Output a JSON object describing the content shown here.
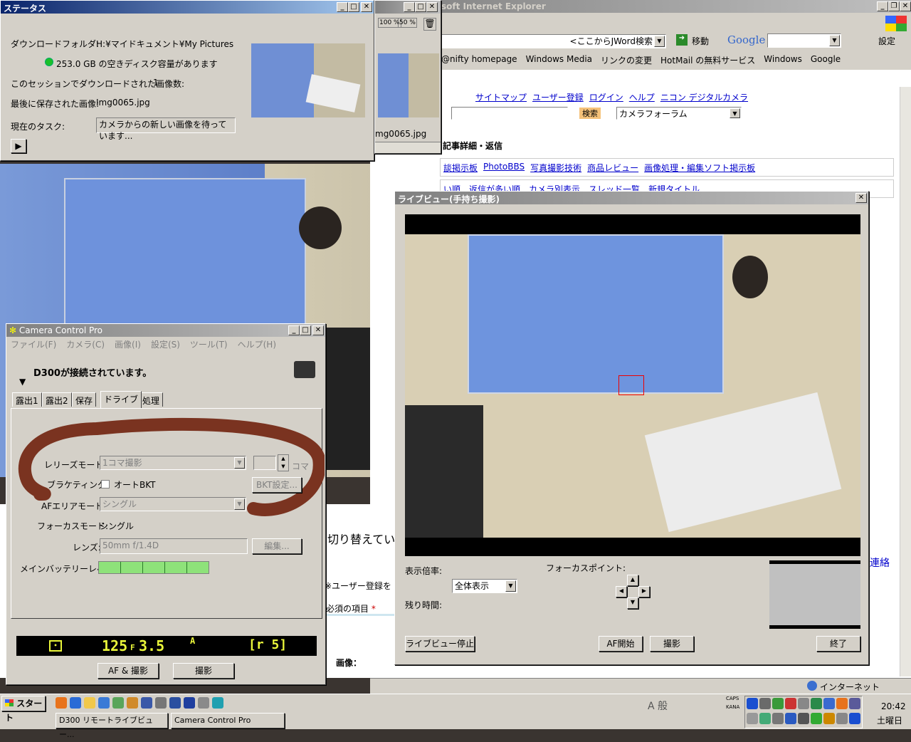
{
  "ie": {
    "title": "soft Internet Explorer",
    "search_hint": "<ここからJWord検索",
    "move_label": "移動",
    "google_label": "Google",
    "settings_label": "設定",
    "links": [
      "@nifty homepage",
      "Windows Media",
      "リンクの変更",
      "HotMail の無料サービス",
      "Windows",
      "Google"
    ],
    "nav_links": [
      "サイトマップ",
      "ユーザー登録",
      "ログイン",
      "ヘルプ",
      "ニコン デジタルカメラ"
    ],
    "search_btn": "検索",
    "forum_select": "カメラフォーラム",
    "heading": "記事詳細・返信",
    "board_links": [
      "談掲示板",
      "PhotoBBS",
      "写真撮影技術",
      "商品レビュー",
      "画像処理・編集ソフト掲示板"
    ],
    "row2": [
      "い順",
      "返信が多い順",
      "カメラ別表示",
      "スレッド一覧",
      "新規タイトル"
    ],
    "switching_text": "切り替えてい",
    "user_reg_text": "※ユーザー登録を",
    "required_text": "必須の項目",
    "required_mark": "*",
    "image_label": "画像：",
    "contact_text": "連絡",
    "status_zone": "インターネット"
  },
  "status": {
    "title": "ステータス",
    "folder_label": "ダウンロードフォルダ:",
    "folder_value": "H:¥マイドキュメント¥My Pictures",
    "disk_text": "253.0 GB の空きディスク容量があります",
    "count_label": "このセッションでダウンロードされた画像数:",
    "count_value": "1",
    "last_label": "最後に保存された画像:",
    "last_value": "Img0065.jpg",
    "task_label": "現在のタスク:",
    "task_value": "カメラからの新しい画像を待っています...",
    "thumb_caption": "mg0065.jpg",
    "zoom1": "100 %",
    "zoom2": "50 %"
  },
  "ccp": {
    "title": "Camera Control Pro",
    "menu": [
      "ファイル(F)",
      "カメラ(C)",
      "画像(I)",
      "設定(S)",
      "ツール(T)",
      "ヘルプ(H)"
    ],
    "connected": "D300が接続されています。",
    "tabs": [
      "露出1",
      "露出2",
      "保存",
      "ドライブ",
      "処理"
    ],
    "release_label": "レリーズモード:",
    "release_value": "1コマ撮影",
    "frames_unit": "コマ",
    "bracket_label": "ブラケティング:",
    "auto_bkt": "オートBKT",
    "bkt_btn": "BKT設定...",
    "af_area_label": "AFエリアモード:",
    "af_area_value": "シングル",
    "focus_mode_label": "フォーカスモード:",
    "focus_mode_value": "シングル",
    "lens_label": "レンズ:",
    "lens_value": "50mm f/1.4D",
    "edit_btn": "編集...",
    "battery_label": "メインバッテリーレベル:",
    "battery_level": 1.0,
    "lcd_shutter": "125",
    "lcd_f": "F",
    "lcd_aperture": "3.5",
    "lcd_mode": "A",
    "lcd_right": "[r 5]",
    "af_shoot_btn": "AF & 撮影",
    "shoot_btn": "撮影"
  },
  "liveview": {
    "title": "ライブビュー(手持ち撮影)",
    "zoom_label": "表示倍率:",
    "zoom_value": "全体表示",
    "remaining_label": "残り時間:",
    "focus_point_label": "フォーカスポイント:",
    "stop_btn": "ライブビュー停止",
    "af_btn": "AF開始",
    "shoot_btn": "撮影",
    "end_btn": "終了"
  },
  "taskbar": {
    "start": "スタート",
    "tasks": [
      "D300 リモートライブビュー...",
      "Camera Control Pro"
    ],
    "ime": "A 般",
    "caps": "CAPS",
    "kana": "KANA",
    "time": "20:42",
    "day": "土曜日"
  }
}
